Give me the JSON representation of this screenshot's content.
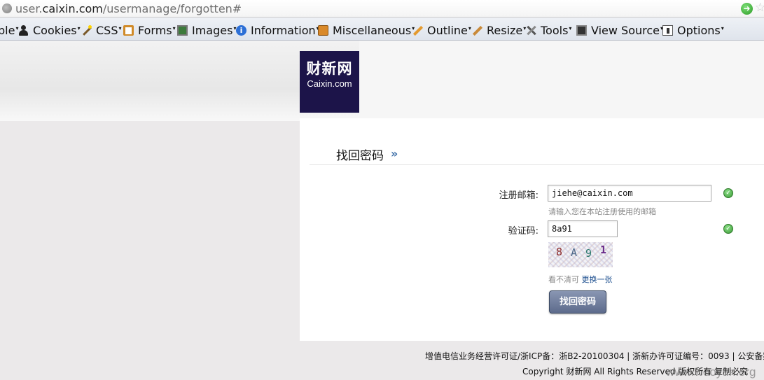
{
  "browser": {
    "url_prefix": "user.",
    "url_host": "caixin.com",
    "url_path": "/usermanage/forgotten#"
  },
  "devtoolbar": {
    "items": [
      {
        "label": "ble",
        "icon": "none"
      },
      {
        "label": "Cookies",
        "icon": "person-icon"
      },
      {
        "label": "CSS",
        "icon": "wand-icon"
      },
      {
        "label": "Forms",
        "icon": "clipboard-icon"
      },
      {
        "label": "Images",
        "icon": "image-icon"
      },
      {
        "label": "Information",
        "icon": "info-icon"
      },
      {
        "label": "Miscellaneous",
        "icon": "box-icon"
      },
      {
        "label": "Outline",
        "icon": "pencil-icon"
      },
      {
        "label": "Resize",
        "icon": "ruler-icon"
      },
      {
        "label": "Tools",
        "icon": "tools-icon"
      },
      {
        "label": "View Source",
        "icon": "monitor-icon"
      },
      {
        "label": "Options",
        "icon": "options-icon"
      }
    ],
    "info_glyph": "i"
  },
  "logo": {
    "cn": "财新网",
    "en": "Caixin.com"
  },
  "form": {
    "title": "找回密码",
    "title_arrow": "»",
    "email_label": "注册邮箱:",
    "email_value": "jiehe@caixin.com",
    "email_hint": "请输入您在本站注册使用的邮箱",
    "code_label": "验证码:",
    "code_value": "8a91",
    "captcha_chars": [
      "8",
      "A",
      "9",
      "1"
    ],
    "captcha_note": "看不清可",
    "captcha_refresh": "更换一张",
    "submit_label": "找回密码",
    "ok_glyph": "✓"
  },
  "footer": {
    "line1": "增值电信业务经营许可证/浙ICP备：浙B2-20100304 | 浙新办许可证编号：0093 | 公安备案编",
    "line2": "Copyright 财新网 All Rights Reserved 版权所有 复制必究",
    "watermark": "www.wooyun.org"
  },
  "colors": {
    "logo_bg": "#1c1449",
    "link": "#1d4f8f",
    "button_top": "#8996b2",
    "button_bottom": "#5d6b8c",
    "ok_green": "#3a9a35"
  }
}
